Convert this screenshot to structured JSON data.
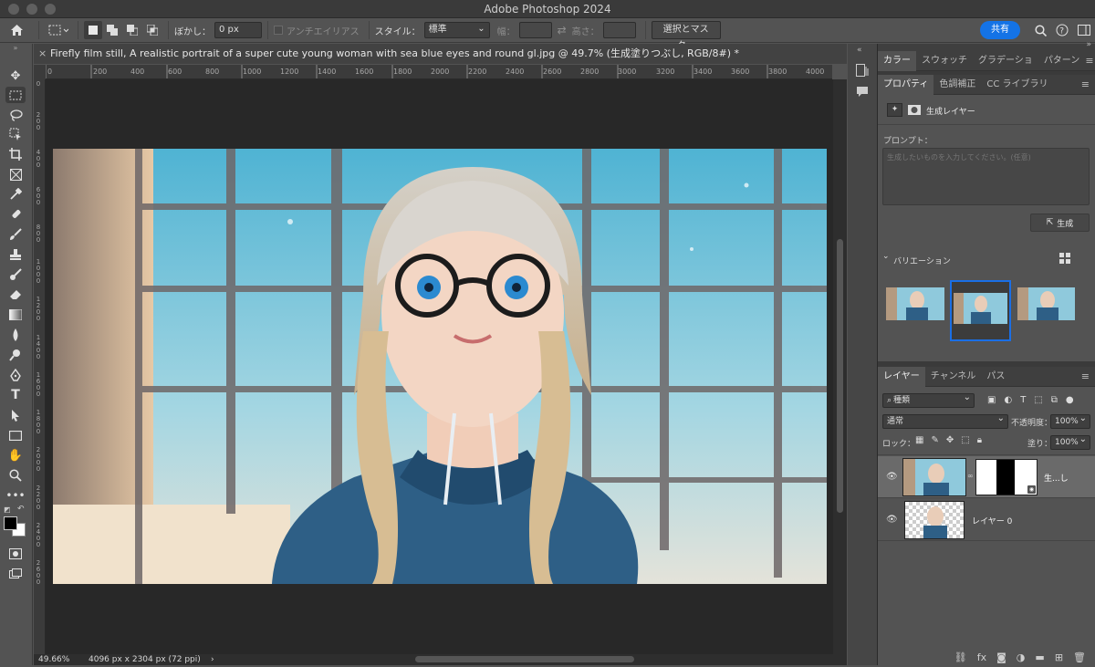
{
  "app": {
    "title": "Adobe Photoshop 2024"
  },
  "options_bar": {
    "feather_label": "ぼかし：",
    "feather_value": "0 px",
    "antialias_label": "アンチエイリアス",
    "style_label": "スタイル：",
    "style_value": "標準",
    "width_label": "幅：",
    "height_label": "高さ：",
    "select_mask_button": "選択とマスク...",
    "share_button": "共有"
  },
  "document": {
    "tab_title": "Firefly film still, A realistic portrait of a super cute young woman with sea blue eyes and round gl.jpg @ 49.7% (生成塗りつぶし, RGB/8#) *",
    "close_symbol": "×",
    "zoom": "49.66%",
    "dimensions": "4096 px x 2304 px (72 ppi)",
    "status_arrow": "›"
  },
  "rulers": {
    "horizontal": [
      "0",
      "200",
      "400",
      "600",
      "800",
      "1000",
      "1200",
      "1400",
      "1600",
      "1800",
      "2000",
      "2200",
      "2400",
      "2600",
      "2800",
      "3000",
      "3200",
      "3400",
      "3600",
      "3800",
      "4000"
    ],
    "vertical": [
      "0",
      "200",
      "400",
      "600",
      "800",
      "1000",
      "1200",
      "1400",
      "1600",
      "1800",
      "2000",
      "2200",
      "2400",
      "2600"
    ]
  },
  "panel_group_top": {
    "tabs": [
      "カラー",
      "スウォッチ",
      "グラデーショ",
      "パターン"
    ]
  },
  "properties": {
    "tabs": [
      "プロパティ",
      "色調補正",
      "CC ライブラリ"
    ],
    "layer_type": "生成レイヤー",
    "prompt_label": "プロンプト：",
    "prompt_placeholder": "生成したいものを入力してください。(任意)",
    "generate_button": "生成",
    "variations_label": "バリエーション"
  },
  "layers": {
    "tabs": [
      "レイヤー",
      "チャンネル",
      "パス"
    ],
    "filter_kind": "種類",
    "blend_mode": "通常",
    "opacity_label": "不透明度：",
    "opacity_value": "100%",
    "lock_label": "ロック：",
    "fill_label": "塗り：",
    "fill_value": "100%",
    "items": [
      {
        "name": "生...し"
      },
      {
        "name": "レイヤー 0"
      }
    ]
  },
  "colors": {
    "accent": "#1473e6",
    "selection": "#2e6bd6"
  }
}
